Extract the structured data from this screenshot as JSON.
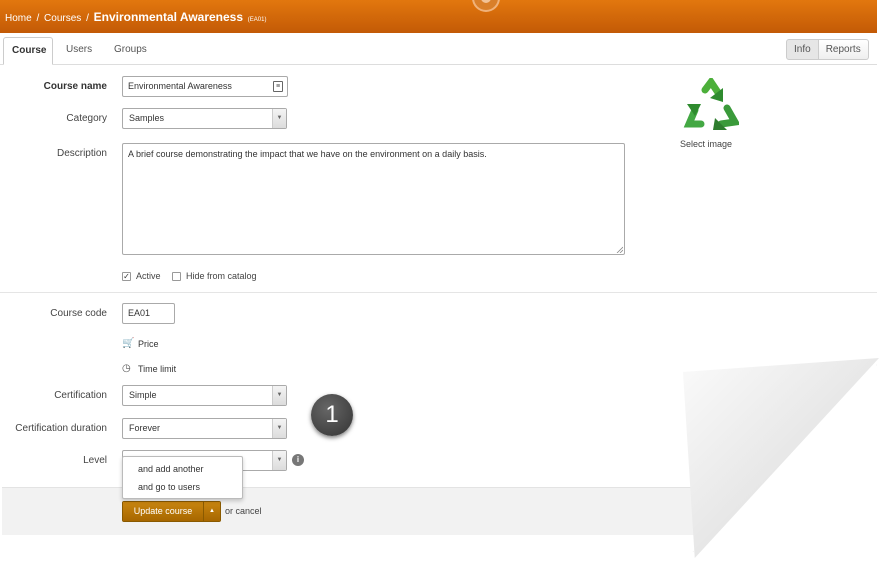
{
  "breadcrumb": {
    "home": "Home",
    "sep": "/",
    "courses": "Courses",
    "title": "Environmental Awareness",
    "code": "(EA01)"
  },
  "tabs": [
    {
      "label": "Course"
    },
    {
      "label": "Users"
    },
    {
      "label": "Groups"
    }
  ],
  "top_buttons": {
    "info": "Info",
    "reports": "Reports"
  },
  "form": {
    "course_name": {
      "label": "Course name",
      "value": "Environmental Awareness"
    },
    "category": {
      "label": "Category",
      "value": "Samples"
    },
    "description": {
      "label": "Description",
      "value": "A brief course demonstrating the impact that we have on the environment on a daily basis."
    },
    "active": {
      "label": "Active",
      "checked": true
    },
    "hide": {
      "label": "Hide from catalog",
      "checked": false
    },
    "course_code": {
      "label": "Course code",
      "value": "EA01"
    },
    "price": {
      "label": "Price"
    },
    "time_limit": {
      "label": "Time limit"
    },
    "certification": {
      "label": "Certification",
      "value": "Simple"
    },
    "cert_duration": {
      "label": "Certification duration",
      "value": "Forever"
    },
    "level": {
      "label": "Level",
      "value": ""
    }
  },
  "image": {
    "select_label": "Select image"
  },
  "dropdown": {
    "opt1": "and add another",
    "opt2": "and go to users"
  },
  "footer": {
    "update": "Update course",
    "or_cancel": "or cancel"
  },
  "badge": "1",
  "colors": {
    "topbar": "#d0660a",
    "button": "#b87400",
    "recycle_green": "#3a9a3a"
  }
}
